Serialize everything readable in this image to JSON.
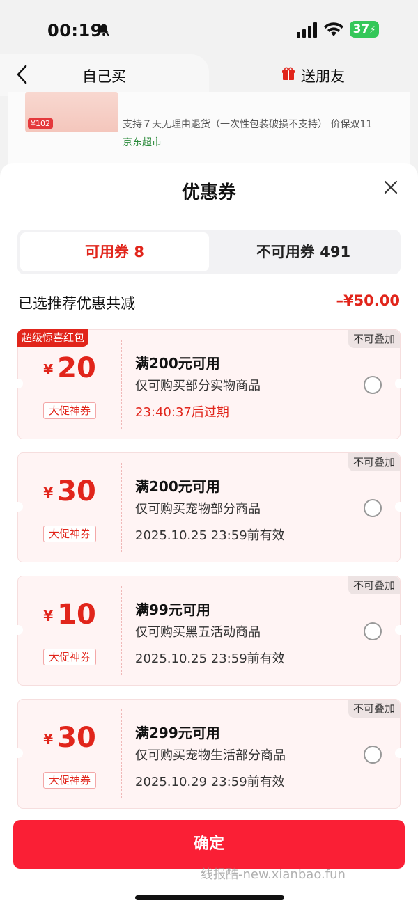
{
  "status_bar": {
    "time": "00:19",
    "battery": "37"
  },
  "background": {
    "tabs": {
      "self_label": "自己买",
      "friend_label": "送朋友"
    },
    "product": {
      "image_price": "¥102",
      "desc": "支持７天无理由退货（一次性包装破损不支持） 价保双11",
      "shop": "京东超市"
    }
  },
  "sheet": {
    "title": "优惠券",
    "tabs": {
      "available": "可用券 8",
      "unavailable": "不可用券 491"
    },
    "summary": {
      "label": "已选推荐优惠共减",
      "value": "–¥50.00"
    },
    "coupons": [
      {
        "badge": "超级惊喜红包",
        "stack": "不可叠加",
        "currency": "¥",
        "value": "20",
        "type": "大促神券",
        "title": "满200元可用",
        "scope": "仅可购买部分实物商品",
        "expiry": "23:40:37后过期",
        "selected": false
      },
      {
        "stack": "不可叠加",
        "currency": "¥",
        "value": "30",
        "type": "大促神券",
        "title": "满200元可用",
        "scope": "仅可购买宠物部分商品",
        "expiry": "2025.10.25 23:59前有效",
        "selected": false
      },
      {
        "stack": "不可叠加",
        "currency": "¥",
        "value": "10",
        "type": "大促神券",
        "title": "满99元可用",
        "scope": "仅可购买黑五活动商品",
        "expiry": "2025.10.25 23:59前有效",
        "selected": false
      },
      {
        "stack": "不可叠加",
        "currency": "¥",
        "value": "30",
        "type": "大促神券",
        "title": "满299元可用",
        "scope": "仅可购买宠物生活部分商品",
        "expiry": "2025.10.29 23:59前有效",
        "selected": false
      }
    ],
    "confirm_label": "确定",
    "watermark": "线报酷-new.xianbao.fun"
  },
  "colors": {
    "accent": "#e1251b",
    "button": "#fa1f35",
    "coupon_bg": "#fff4f4"
  }
}
